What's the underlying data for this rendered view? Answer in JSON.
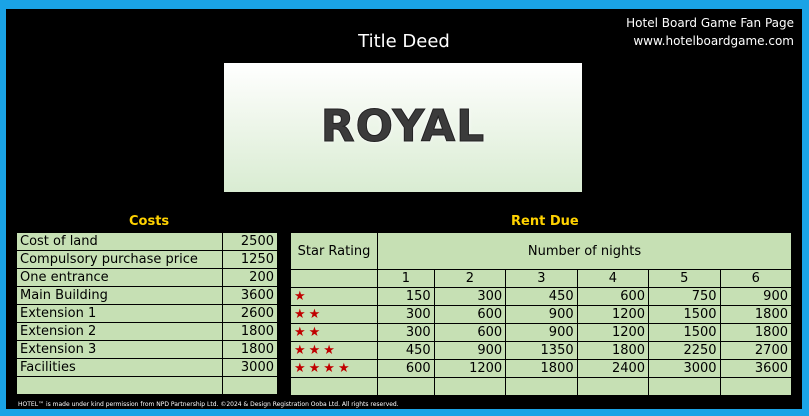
{
  "header": {
    "site_name": "Hotel Board Game Fan Page",
    "site_url": "www.hotelboardgame.com",
    "title": "Title Deed"
  },
  "banner": {
    "hotel_name": "ROYAL"
  },
  "costs": {
    "heading": "Costs",
    "rows": [
      {
        "label": "Cost of land",
        "value": "2500"
      },
      {
        "label": "Compulsory purchase price",
        "value": "1250"
      },
      {
        "label": "One entrance",
        "value": "200"
      },
      {
        "label": "Main Building",
        "value": "3600"
      },
      {
        "label": "Extension 1",
        "value": "2600"
      },
      {
        "label": "Extension 2",
        "value": "1800"
      },
      {
        "label": "Extension 3",
        "value": "1800"
      },
      {
        "label": "Facilities",
        "value": "3000"
      }
    ]
  },
  "rent": {
    "heading": "Rent Due",
    "star_rating_header": "Star Rating",
    "nights_header": "Number of nights",
    "nights": [
      "1",
      "2",
      "3",
      "4",
      "5",
      "6"
    ],
    "rows": [
      {
        "stars": "★",
        "values": [
          "150",
          "300",
          "450",
          "600",
          "750",
          "900"
        ]
      },
      {
        "stars": "★★",
        "values": [
          "300",
          "600",
          "900",
          "1200",
          "1500",
          "1800"
        ]
      },
      {
        "stars": "★★",
        "values": [
          "300",
          "600",
          "900",
          "1200",
          "1500",
          "1800"
        ]
      },
      {
        "stars": "★★★",
        "values": [
          "450",
          "900",
          "1350",
          "1800",
          "2250",
          "2700"
        ]
      },
      {
        "stars": "★★★★",
        "values": [
          "600",
          "1200",
          "1800",
          "2400",
          "3000",
          "3600"
        ]
      }
    ]
  },
  "footer": {
    "text": "HOTEL™ is made under kind permission from NPD Partnership Ltd. ©2024 & Design Registration Ooba Ltd. All rights reserved."
  },
  "colors": {
    "frame": "#1aa3e6",
    "card": "#000000",
    "cell": "#c6e0b4",
    "heading": "#ffd200",
    "star": "#c00000"
  }
}
